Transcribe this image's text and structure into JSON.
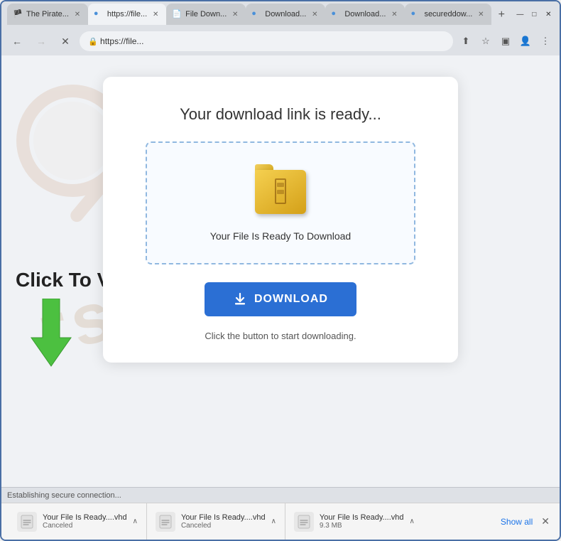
{
  "window": {
    "controls": {
      "minimize": "—",
      "maximize": "□",
      "close": "✕"
    }
  },
  "tabs": [
    {
      "id": "tab1",
      "favicon": "🏴",
      "label": "The Pirate...",
      "active": false
    },
    {
      "id": "tab2",
      "favicon": "🔵",
      "label": "https://file...",
      "active": true
    },
    {
      "id": "tab3",
      "favicon": "📄",
      "label": "File Down...",
      "active": false
    },
    {
      "id": "tab4",
      "favicon": "🔵",
      "label": "Download...",
      "active": false
    },
    {
      "id": "tab5",
      "favicon": "🔵",
      "label": "Download...",
      "active": false
    },
    {
      "id": "tab6",
      "favicon": "🔵",
      "label": "secureddow...",
      "active": false
    }
  ],
  "address_bar": {
    "url": "https://file...",
    "icons": [
      "share",
      "star",
      "sidebar",
      "profile",
      "menu"
    ]
  },
  "page": {
    "card": {
      "title": "Your download link is ready...",
      "file_box": {
        "file_ready_text": "Your File Is Ready To Download"
      },
      "download_button": "DOWNLOAD",
      "hint_text": "Click the button to start downloading."
    },
    "click_to_view": "Click To View",
    "watermark": "rsk.com"
  },
  "status_bar": {
    "text": "Establishing secure connection..."
  },
  "downloads_bar": {
    "items": [
      {
        "filename": "Your File Is Ready....vhd",
        "status": "Canceled"
      },
      {
        "filename": "Your File Is Ready....vhd",
        "status": "Canceled"
      },
      {
        "filename": "Your File Is Ready....vhd",
        "status": "9.3 MB"
      }
    ],
    "show_all": "Show all",
    "close": "✕"
  }
}
